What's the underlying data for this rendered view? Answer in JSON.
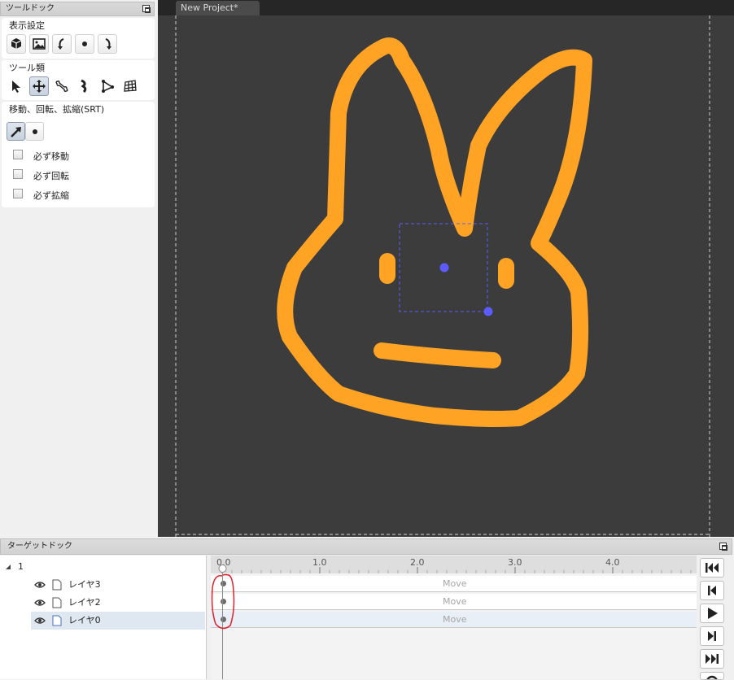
{
  "tooldock": {
    "title": "ツールドック",
    "display_settings": {
      "label": "表示設定",
      "buttons": [
        "cube-icon",
        "image-icon",
        "rotate-left-icon",
        "dot-icon",
        "rotate-right-icon"
      ]
    },
    "tools": {
      "label": "ツール類",
      "buttons": [
        "arrow-select-icon",
        "move-cross-icon",
        "bone-icon",
        "bend-icon",
        "mesh-vertex-icon",
        "grid-mesh-icon"
      ]
    },
    "srt": {
      "label": "移動、回転、拡縮(SRT)",
      "buttons": [
        "srt-arrow-icon",
        "dot-icon"
      ],
      "checkboxes": [
        {
          "label": "必ず移動",
          "checked": false
        },
        {
          "label": "必ず回転",
          "checked": false
        },
        {
          "label": "必ず拡縮",
          "checked": false
        }
      ]
    }
  },
  "editor": {
    "tab_title": "New Project*",
    "stroke_color": "#ffa325",
    "handle_color": "#5b5bff"
  },
  "targetdock": {
    "title": "ターゲットドック",
    "root": {
      "label": "1"
    },
    "layers": [
      {
        "label": "レイヤ3",
        "visible": true,
        "selected": false
      },
      {
        "label": "レイヤ2",
        "visible": true,
        "selected": false
      },
      {
        "label": "レイヤ0",
        "visible": true,
        "selected": true
      }
    ],
    "timeline": {
      "ticks": [
        "0.0",
        "1.0",
        "2.0",
        "3.0",
        "4.0"
      ],
      "tracks": [
        "Move",
        "Move",
        "Move"
      ],
      "annotation_color": "#e0202a"
    },
    "transport": [
      "first-frame-icon",
      "prev-frame-icon",
      "play-icon",
      "next-frame-icon",
      "last-frame-icon"
    ]
  }
}
